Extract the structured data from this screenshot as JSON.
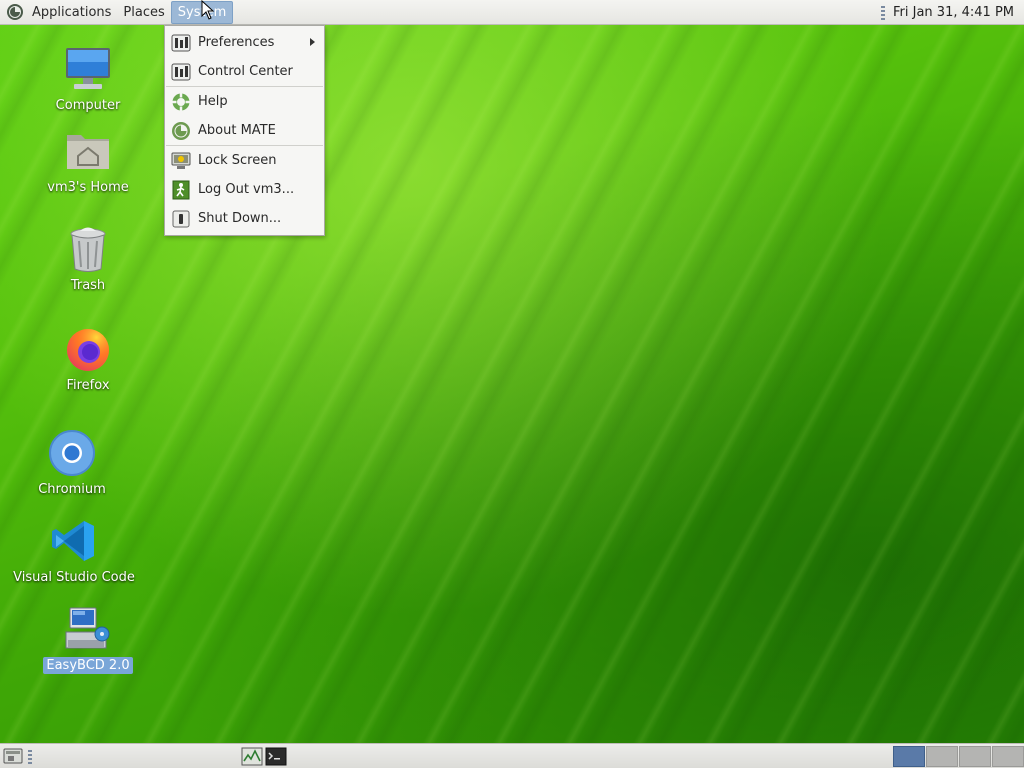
{
  "top_panel": {
    "menus": [
      "Applications",
      "Places",
      "System"
    ],
    "active_menu": "System",
    "clock": "Fri Jan 31,  4:41 PM"
  },
  "system_menu": {
    "groups": [
      [
        {
          "label": "Preferences",
          "icon": "preferences-icon",
          "submenu": true
        },
        {
          "label": "Control Center",
          "icon": "control-center-icon"
        }
      ],
      [
        {
          "label": "Help",
          "icon": "help-icon"
        },
        {
          "label": "About MATE",
          "icon": "mate-logo-icon"
        }
      ],
      [
        {
          "label": "Lock Screen",
          "icon": "lock-screen-icon"
        },
        {
          "label": "Log Out vm3...",
          "icon": "log-out-icon"
        },
        {
          "label": "Shut Down...",
          "icon": "shutdown-icon"
        }
      ]
    ]
  },
  "desktop_icons": [
    {
      "label": "Computer",
      "icon": "computer-icon"
    },
    {
      "label": "vm3's Home",
      "icon": "home-folder-icon"
    },
    {
      "label": "Trash",
      "icon": "trash-icon"
    },
    {
      "label": "Firefox",
      "icon": "firefox-icon"
    },
    {
      "label": "Chromium",
      "icon": "chromium-icon"
    },
    {
      "label": "Visual Studio Code",
      "icon": "vscode-icon"
    },
    {
      "label": "EasyBCD 2.0",
      "icon": "easybcd-icon",
      "selected": true
    }
  ],
  "bottom_panel": {
    "workspaces": 4,
    "active_workspace": 1
  },
  "colors": {
    "accent": "#9cb8d6",
    "selection": "#7aa6d8",
    "wallpaper": "#4fb80a"
  }
}
